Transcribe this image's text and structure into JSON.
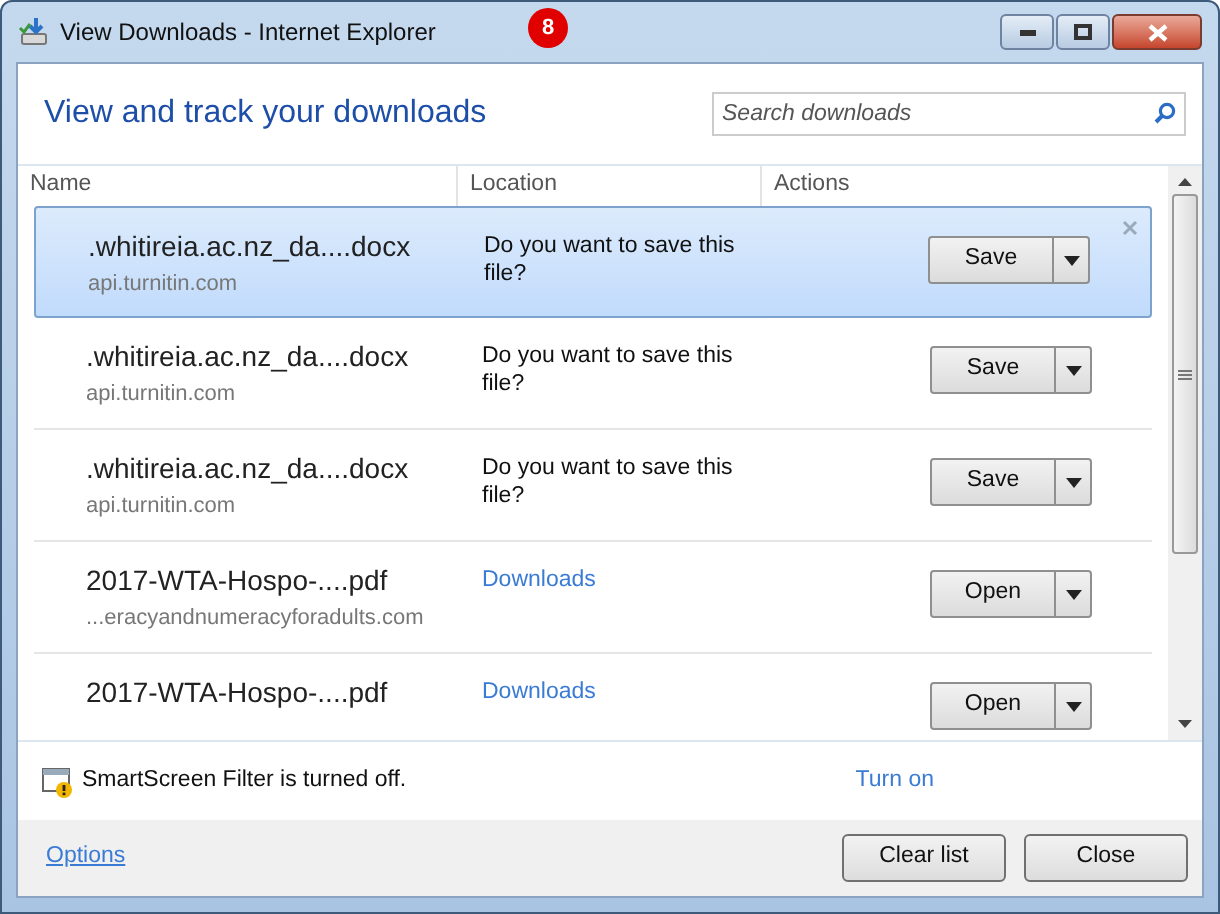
{
  "window": {
    "title": "View Downloads - Internet Explorer",
    "badge": "8"
  },
  "header": {
    "title": "View and track your downloads",
    "search": {
      "placeholder": "Search downloads"
    }
  },
  "table": {
    "columns": [
      "Name",
      "Location",
      "Actions"
    ],
    "rows": [
      {
        "name": ".whitireia.ac.nz_da....docx",
        "source": "api.turnitin.com",
        "location": {
          "kind": "prompt",
          "text": "Do you want to save this file?"
        },
        "action": "Save",
        "selected": true
      },
      {
        "name": ".whitireia.ac.nz_da....docx",
        "source": "api.turnitin.com",
        "location": {
          "kind": "prompt",
          "text": "Do you want to save this file?"
        },
        "action": "Save",
        "selected": false
      },
      {
        "name": ".whitireia.ac.nz_da....docx",
        "source": "api.turnitin.com",
        "location": {
          "kind": "prompt",
          "text": "Do you want to save this file?"
        },
        "action": "Save",
        "selected": false
      },
      {
        "name": "2017-WTA-Hospo-....pdf",
        "source": "...eracyandnumeracyforadults.com",
        "location": {
          "kind": "link",
          "text": "Downloads"
        },
        "action": "Open",
        "selected": false
      },
      {
        "name": "2017-WTA-Hospo-....pdf",
        "location": {
          "kind": "link",
          "text": "Downloads"
        },
        "action": "Open",
        "selected": false
      }
    ]
  },
  "smartscreen": {
    "message": "SmartScreen Filter is turned off.",
    "link": "Turn on"
  },
  "footer": {
    "link": "Options",
    "buttons": [
      "Clear list",
      "Close"
    ]
  }
}
